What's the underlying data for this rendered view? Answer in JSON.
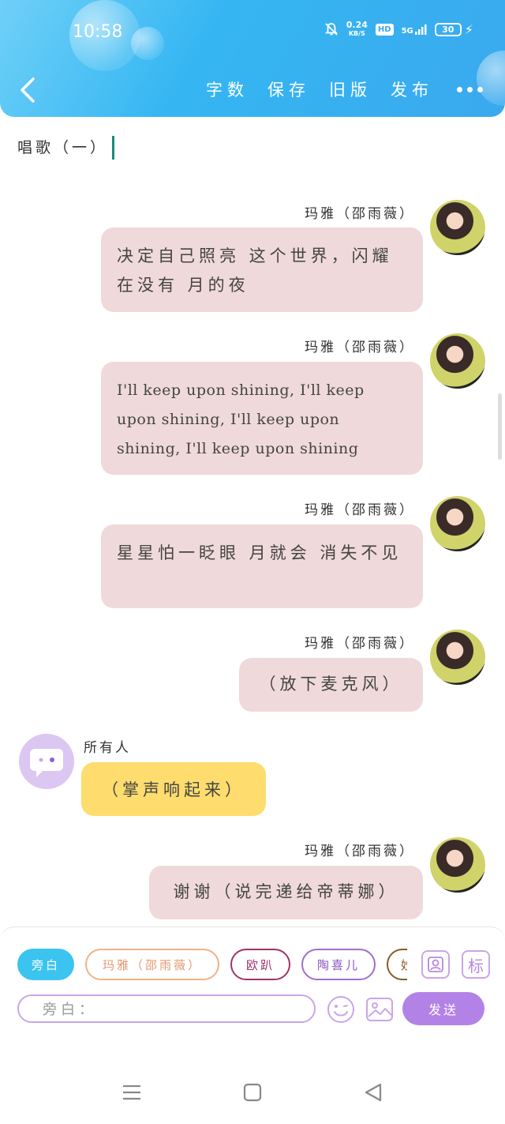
{
  "status_bar": {
    "time": "10:58",
    "net_speed_value": "0.24",
    "net_speed_unit": "KB/S",
    "hd_label": "HD",
    "signal_label": "5G",
    "battery": "30"
  },
  "header": {
    "actions": [
      "字数",
      "保存",
      "旧版",
      "发布"
    ]
  },
  "chapter_title": "唱歌（一）",
  "messages": [
    {
      "speaker": "玛雅（邵雨薇）",
      "text": "决定自己照亮 这个世界，闪耀在没有 月的夜"
    },
    {
      "speaker": "玛雅（邵雨薇）",
      "text": "I'll keep upon shining, I'll keep upon shining, I'll keep upon shining, I'll keep upon shining"
    },
    {
      "speaker": "玛雅（邵雨薇）",
      "text": "星星怕一眨眼 月就会 消失不见"
    },
    {
      "speaker": "玛雅（邵雨薇）",
      "text": "（放下麦克风）"
    },
    {
      "speaker": "所有人",
      "text": "（掌声响起来）"
    },
    {
      "speaker": "玛雅（邵雨薇）",
      "text": "谢谢（说完递给帝蒂娜）"
    }
  ],
  "composer": {
    "chips": [
      "旁白",
      "玛雅（邵雨薇）",
      "欧趴",
      "陶喜儿",
      "妙"
    ],
    "role_button_icon": "role-avatar-icon",
    "tag_button_label": "标",
    "input_placeholder": "旁白：",
    "send_label": "发送"
  },
  "colors": {
    "header_blue": "#35b6f2",
    "pink_bubble": "#f0d9da",
    "yellow_bubble": "#fedd6e",
    "send_purple": "#b382e6",
    "narration_chip": "#3cc4f0"
  }
}
